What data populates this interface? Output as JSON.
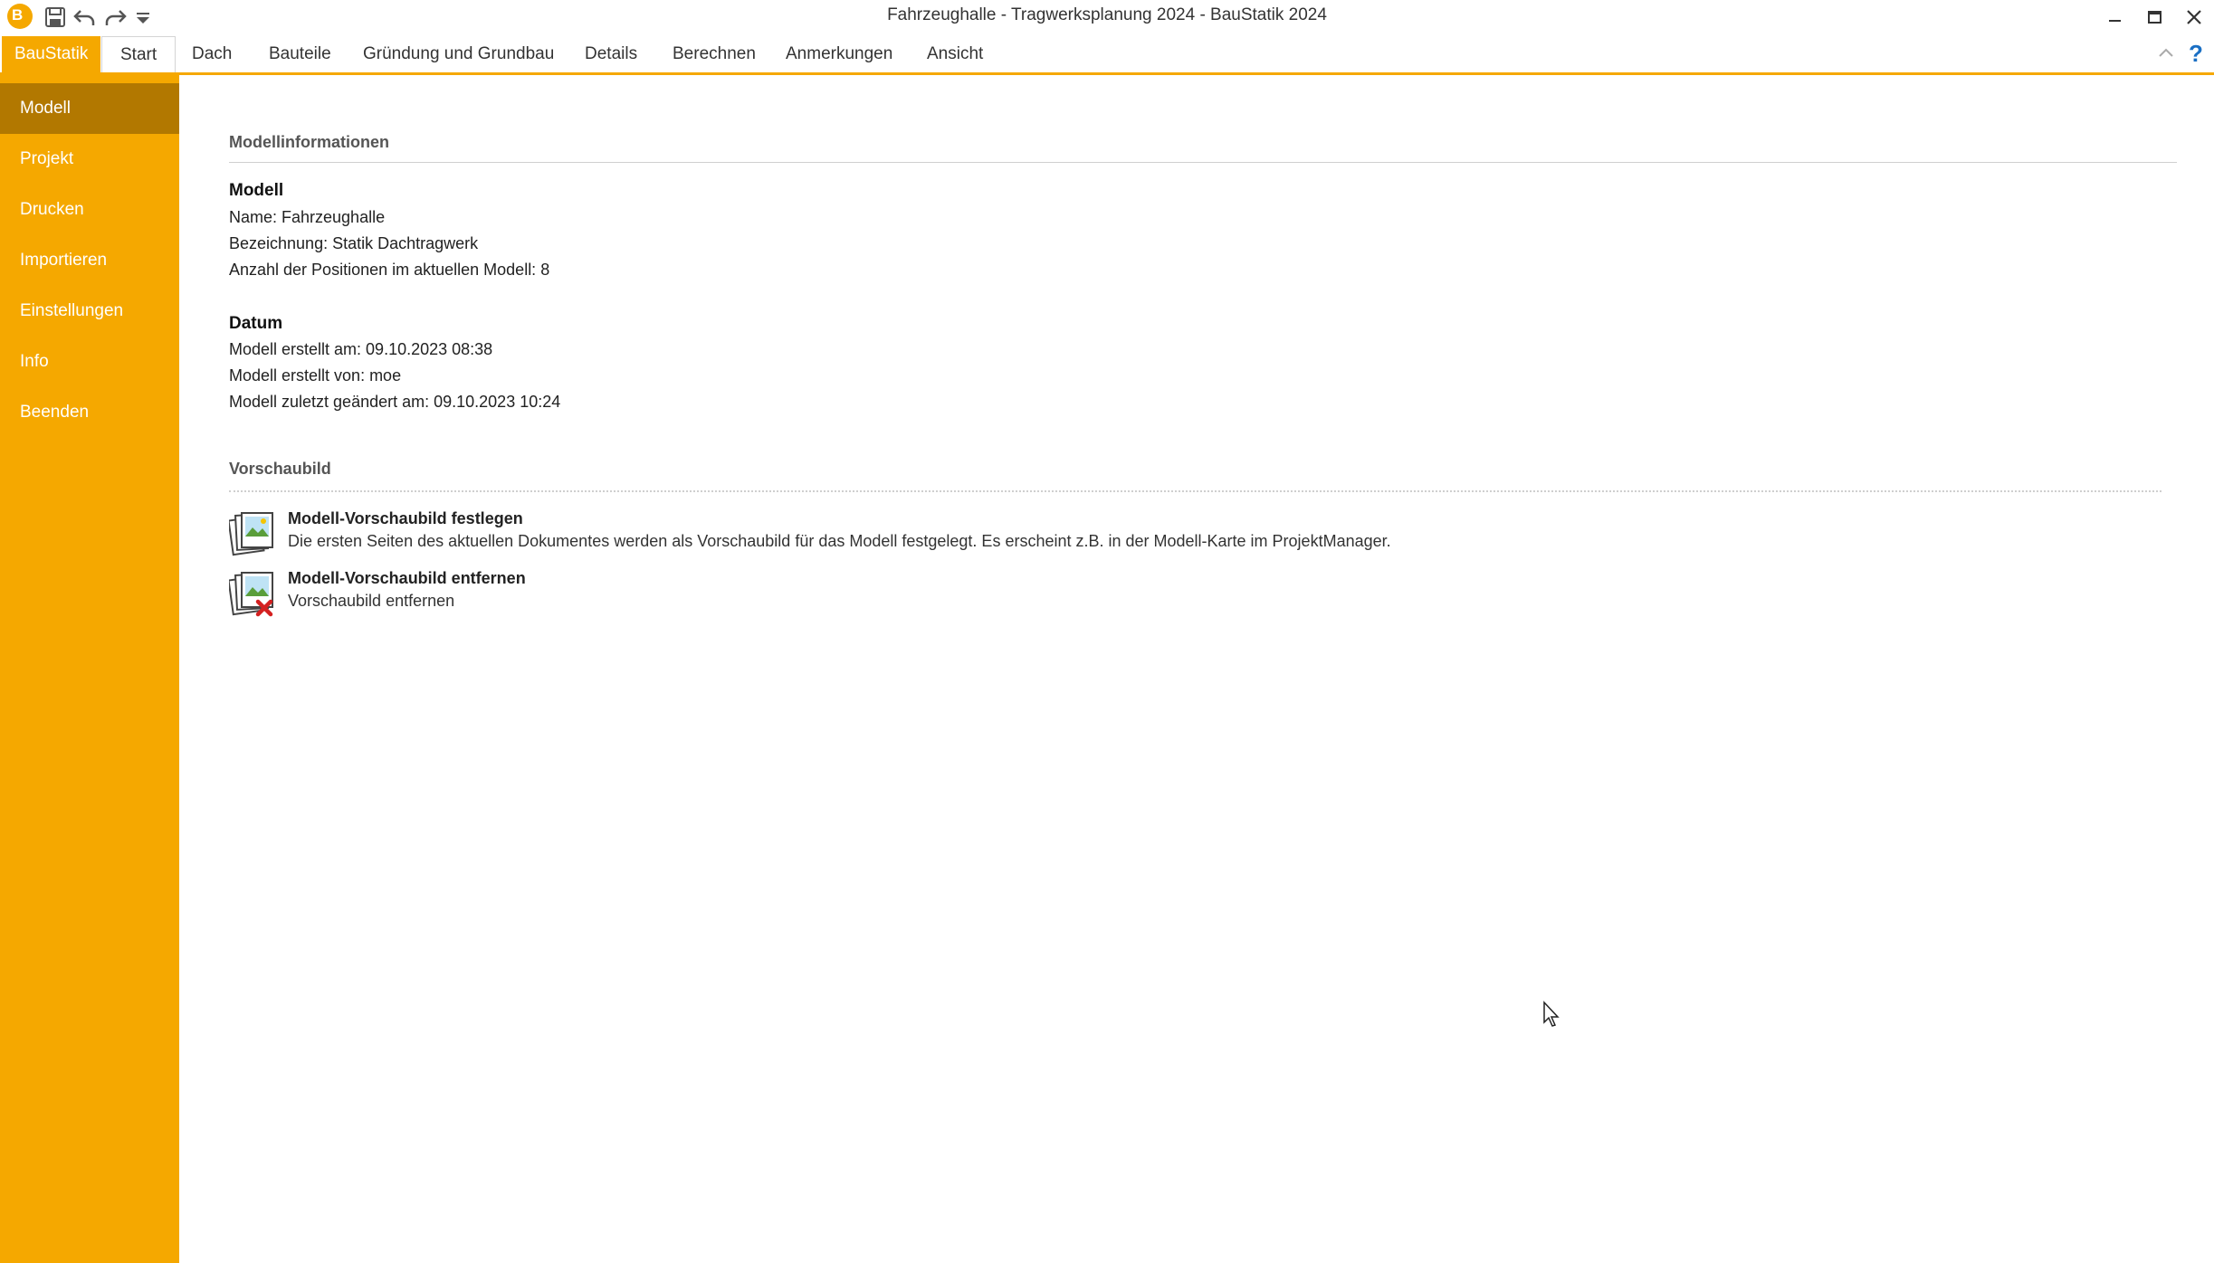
{
  "window": {
    "title": "Fahrzeughalle - Tragwerksplanung 2024 - BauStatik 2024",
    "quick_access": [
      "app-logo-icon",
      "save-icon",
      "undo-icon",
      "redo-icon",
      "customize-icon"
    ],
    "controls": [
      "minimize-icon",
      "maximize-icon",
      "close-icon"
    ]
  },
  "ribbon": {
    "file_tab": "BauStatik",
    "tabs": [
      "Start",
      "Dach",
      "Bauteile",
      "Gründung und Grundbau",
      "Details",
      "Berechnen",
      "Anmerkungen",
      "Ansicht"
    ],
    "active_tab": "Start",
    "right_icons": [
      "collapse-ribbon-icon",
      "help-icon"
    ]
  },
  "sidebar": {
    "items": [
      "Modell",
      "Projekt",
      "Drucken",
      "Importieren",
      "Einstellungen",
      "Info",
      "Beenden"
    ],
    "active": "Modell"
  },
  "modellinformationen": {
    "heading": "Modellinformationen",
    "modell": {
      "label": "Modell",
      "name": "Name: Fahrzeughalle",
      "bezeichnung": "Bezeichnung: Statik Dachtragwerk",
      "positionen": "Anzahl der Positionen im aktuellen Modell: 8"
    },
    "datum": {
      "label": "Datum",
      "erstellt_am": "Modell erstellt am: 09.10.2023 08:38",
      "erstellt_von": "Modell erstellt von: moe",
      "geaendert_am": "Modell zuletzt geändert am: 09.10.2023 10:24"
    }
  },
  "vorschaubild": {
    "heading": "Vorschaubild",
    "actions": [
      {
        "title": "Modell-Vorschaubild festlegen",
        "description": "Die ersten Seiten des aktuellen Dokumentes werden als Vorschaubild für das Modell festgelegt. Es erscheint z.B. in der Modell-Karte im ProjektManager.",
        "icon": "set-preview-image-icon"
      },
      {
        "title": "Modell-Vorschaubild entfernen",
        "description": "Vorschaubild entfernen",
        "icon": "remove-preview-image-icon"
      }
    ]
  },
  "colors": {
    "accent": "#f5a800",
    "sidebar_active": "#b27800",
    "remove_x": "#d42020"
  }
}
